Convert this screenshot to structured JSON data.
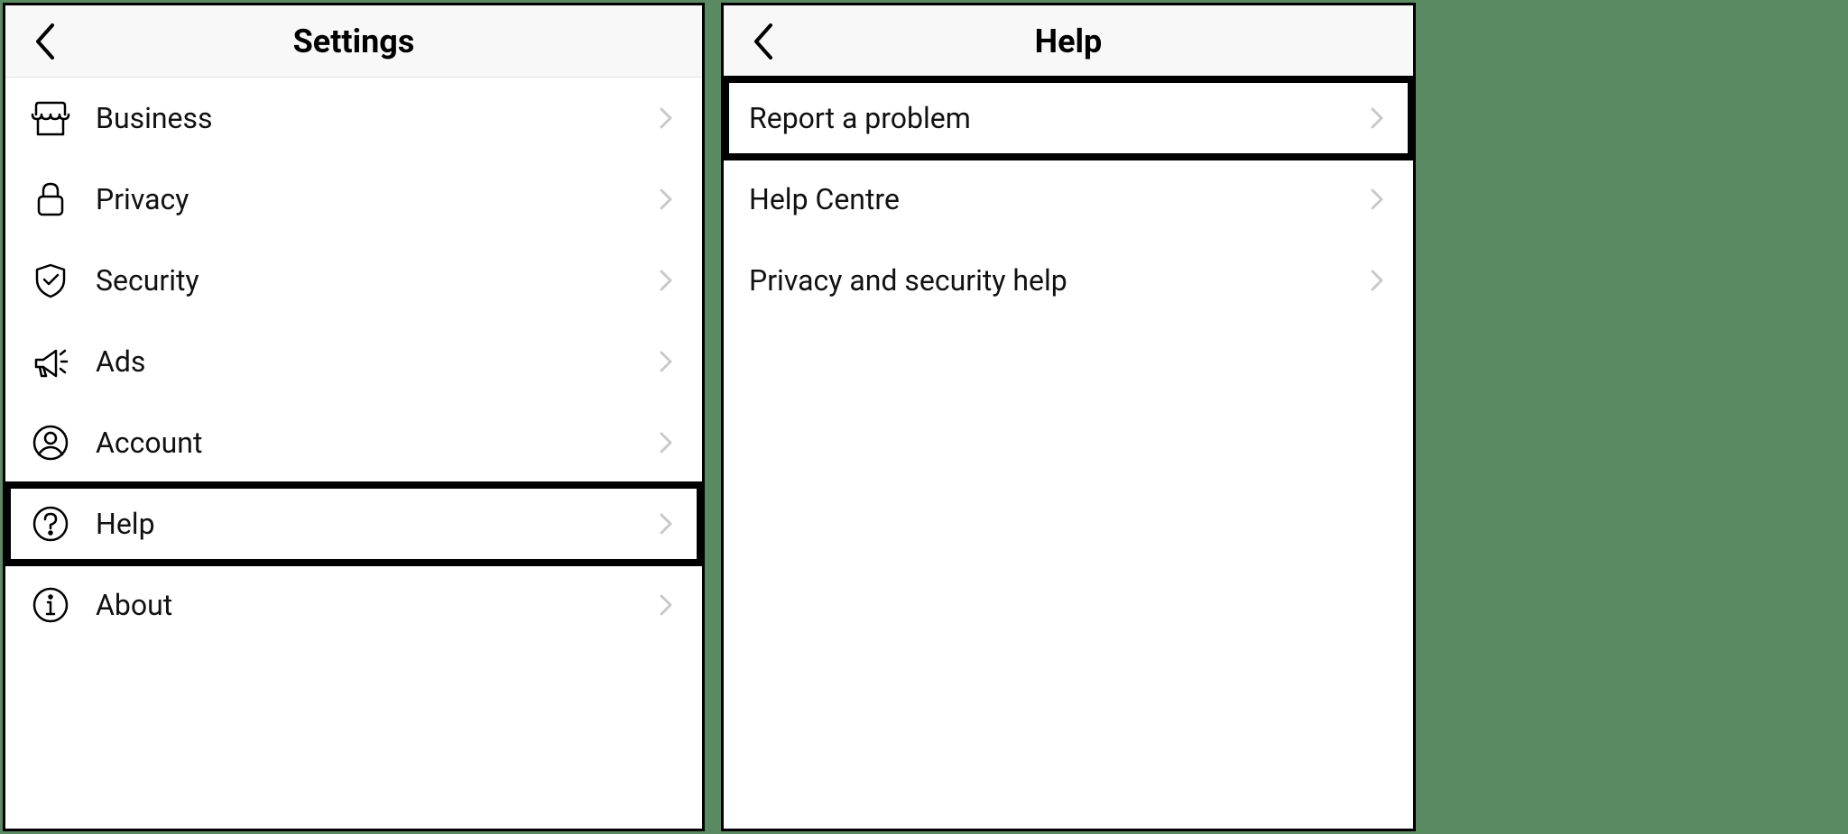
{
  "left": {
    "title": "Settings",
    "items": [
      {
        "icon": "storefront",
        "label": "Business",
        "highlight": false
      },
      {
        "icon": "lock",
        "label": "Privacy",
        "highlight": false
      },
      {
        "icon": "shield",
        "label": "Security",
        "highlight": false
      },
      {
        "icon": "megaphone",
        "label": "Ads",
        "highlight": false
      },
      {
        "icon": "account",
        "label": "Account",
        "highlight": false
      },
      {
        "icon": "help",
        "label": "Help",
        "highlight": true
      },
      {
        "icon": "info",
        "label": "About",
        "highlight": false
      }
    ]
  },
  "right": {
    "title": "Help",
    "items": [
      {
        "label": "Report a problem",
        "highlight": true
      },
      {
        "label": "Help Centre",
        "highlight": false
      },
      {
        "label": "Privacy and security help",
        "highlight": false
      }
    ]
  }
}
